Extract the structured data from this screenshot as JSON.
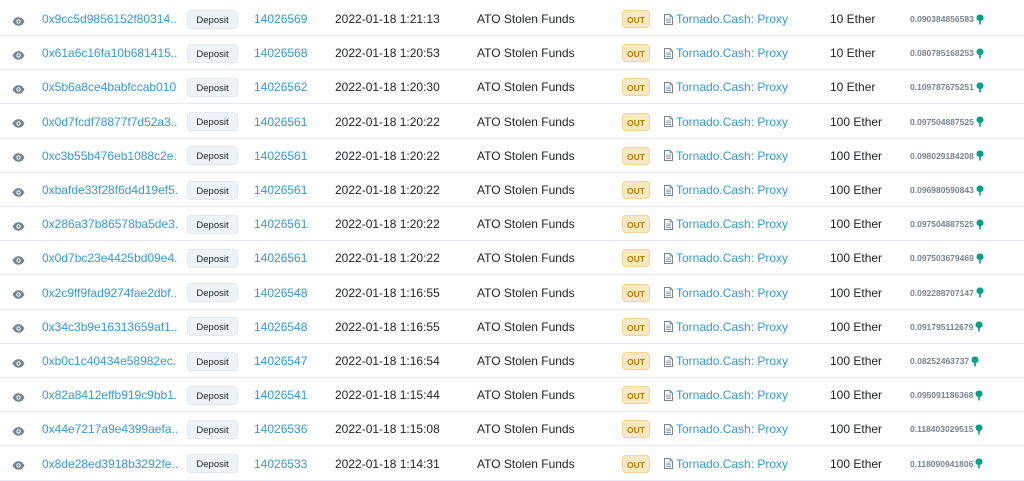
{
  "icons": {
    "preview": "eye-icon",
    "contract": "document-icon",
    "gas": "gas-pump-icon"
  },
  "colors": {
    "link": "#3498db",
    "out_badge_bg": "#f8e8c4",
    "out_badge_text": "#b47d00",
    "gas_icon": "#00a186"
  },
  "transactions": [
    {
      "hash": "0x9cc5d9856152f80314...",
      "method": "Deposit",
      "block": "14026569",
      "age": "2022-01-18 1:21:13",
      "from": "ATO Stolen Funds",
      "direction": "OUT",
      "to": "Tornado.Cash: Proxy",
      "value": "10 Ether",
      "fee": "0.090384856583"
    },
    {
      "hash": "0x61a6c16fa10b681415...",
      "method": "Deposit",
      "block": "14026568",
      "age": "2022-01-18 1:20:53",
      "from": "ATO Stolen Funds",
      "direction": "OUT",
      "to": "Tornado.Cash: Proxy",
      "value": "10 Ether",
      "fee": "0.080785168253"
    },
    {
      "hash": "0x5b6a8ce4babfccab010...",
      "method": "Deposit",
      "block": "14026562",
      "age": "2022-01-18 1:20:30",
      "from": "ATO Stolen Funds",
      "direction": "OUT",
      "to": "Tornado.Cash: Proxy",
      "value": "10 Ether",
      "fee": "0.109787675251"
    },
    {
      "hash": "0x0d7fcdf78877f7d52a3...",
      "method": "Deposit",
      "block": "14026561",
      "age": "2022-01-18 1:20:22",
      "from": "ATO Stolen Funds",
      "direction": "OUT",
      "to": "Tornado.Cash: Proxy",
      "value": "100 Ether",
      "fee": "0.097504887525"
    },
    {
      "hash": "0xc3b55b476eb1088c2e...",
      "method": "Deposit",
      "block": "14026561",
      "age": "2022-01-18 1:20:22",
      "from": "ATO Stolen Funds",
      "direction": "OUT",
      "to": "Tornado.Cash: Proxy",
      "value": "100 Ether",
      "fee": "0.098029184208"
    },
    {
      "hash": "0xbafde33f28f6d4d19ef5...",
      "method": "Deposit",
      "block": "14026561",
      "age": "2022-01-18 1:20:22",
      "from": "ATO Stolen Funds",
      "direction": "OUT",
      "to": "Tornado.Cash: Proxy",
      "value": "100 Ether",
      "fee": "0.096980590843"
    },
    {
      "hash": "0x286a37b86578ba5de3...",
      "method": "Deposit",
      "block": "14026561",
      "age": "2022-01-18 1:20:22",
      "from": "ATO Stolen Funds",
      "direction": "OUT",
      "to": "Tornado.Cash: Proxy",
      "value": "100 Ether",
      "fee": "0.097504887525"
    },
    {
      "hash": "0x0d7bc23e4425bd09e4...",
      "method": "Deposit",
      "block": "14026561",
      "age": "2022-01-18 1:20:22",
      "from": "ATO Stolen Funds",
      "direction": "OUT",
      "to": "Tornado.Cash: Proxy",
      "value": "100 Ether",
      "fee": "0.097503679469"
    },
    {
      "hash": "0x2c9ff9fad9274fae2dbf...",
      "method": "Deposit",
      "block": "14026548",
      "age": "2022-01-18 1:16:55",
      "from": "ATO Stolen Funds",
      "direction": "OUT",
      "to": "Tornado.Cash: Proxy",
      "value": "100 Ether",
      "fee": "0.092288707147"
    },
    {
      "hash": "0x34c3b9e16313659af1...",
      "method": "Deposit",
      "block": "14026548",
      "age": "2022-01-18 1:16:55",
      "from": "ATO Stolen Funds",
      "direction": "OUT",
      "to": "Tornado.Cash: Proxy",
      "value": "100 Ether",
      "fee": "0.091795112679"
    },
    {
      "hash": "0xb0c1c40434e58982ec...",
      "method": "Deposit",
      "block": "14026547",
      "age": "2022-01-18 1:16:54",
      "from": "ATO Stolen Funds",
      "direction": "OUT",
      "to": "Tornado.Cash: Proxy",
      "value": "100 Ether",
      "fee": "0.08252463737"
    },
    {
      "hash": "0x82a8412effb919c9bb1...",
      "method": "Deposit",
      "block": "14026541",
      "age": "2022-01-18 1:15:44",
      "from": "ATO Stolen Funds",
      "direction": "OUT",
      "to": "Tornado.Cash: Proxy",
      "value": "100 Ether",
      "fee": "0.095091186368"
    },
    {
      "hash": "0x44e7217a9e4399aefa...",
      "method": "Deposit",
      "block": "14026536",
      "age": "2022-01-18 1:15:08",
      "from": "ATO Stolen Funds",
      "direction": "OUT",
      "to": "Tornado.Cash: Proxy",
      "value": "100 Ether",
      "fee": "0.118403029515"
    },
    {
      "hash": "0x8de28ed3918b3292fe...",
      "method": "Deposit",
      "block": "14026533",
      "age": "2022-01-18 1:14:31",
      "from": "ATO Stolen Funds",
      "direction": "OUT",
      "to": "Tornado.Cash: Proxy",
      "value": "100 Ether",
      "fee": "0.118090941806"
    }
  ]
}
